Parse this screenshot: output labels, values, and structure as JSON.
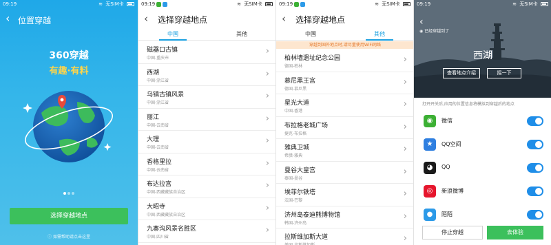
{
  "statusbar": {
    "time": "09:19",
    "carrier": "无SIM卡"
  },
  "panel1": {
    "back_icon": "chevron-left-icon",
    "title": "位置穿越",
    "brand_line1": "360穿越",
    "brand_line2": "有趣·有料",
    "button": "选择穿越地点",
    "hint": "如需帮助请点击这里",
    "colors": {
      "bg": "#1fa8e8",
      "button": "#3cc05c",
      "accent": "#ffd54a"
    }
  },
  "panel2": {
    "title": "选择穿越地点",
    "tabs": [
      "中国",
      "其他"
    ],
    "active_tab": 0,
    "items": [
      {
        "name": "磁器口古镇",
        "sub": "中国-重庆市"
      },
      {
        "name": "西湖",
        "sub": "中国-浙江省"
      },
      {
        "name": "乌镇古镇风景",
        "sub": "中国-浙江省"
      },
      {
        "name": "丽江",
        "sub": "中国-云南省"
      },
      {
        "name": "大理",
        "sub": "中国-云南省"
      },
      {
        "name": "香格里拉",
        "sub": "中国-云南省"
      },
      {
        "name": "布达拉宫",
        "sub": "中国-西藏藏族自治区"
      },
      {
        "name": "大昭寺",
        "sub": "中国-西藏藏族自治区"
      },
      {
        "name": "九寨沟风景名胜区",
        "sub": "中国-四川省"
      }
    ]
  },
  "panel3": {
    "title": "选择穿越地点",
    "tabs": [
      "中国",
      "其他"
    ],
    "active_tab": 1,
    "notice": "穿越到国外地点时,请尽量使用WiFi网络",
    "items": [
      {
        "name": "柏林墙遗址纪念公园",
        "sub": "德国-柏林"
      },
      {
        "name": "慕尼黑王宫",
        "sub": "德国-慕尼黑"
      },
      {
        "name": "星光大道",
        "sub": "中国-香港"
      },
      {
        "name": "布拉格老城广场",
        "sub": "捷克-布拉格"
      },
      {
        "name": "雅典卫城",
        "sub": "希腊-雅典"
      },
      {
        "name": "曼谷大皇宫",
        "sub": "泰国-曼谷"
      },
      {
        "name": "埃菲尔铁塔",
        "sub": "法国-巴黎"
      },
      {
        "name": "济州岛泰迪熊博物馆",
        "sub": "韩国-济州岛"
      },
      {
        "name": "拉斯维加斯大道",
        "sub": "美国-拉斯维加斯"
      }
    ]
  },
  "panel4": {
    "small": "已经穿越到了",
    "place": "西湖",
    "btn_info": "查看地点介绍",
    "btn_shake": "摇一下",
    "perm_note": "打开开关后,应用的位置信息将模拟到穿越后的地点",
    "apps": [
      {
        "name": "微信",
        "icon": "wechat-icon",
        "color": "#3cb034",
        "on": true
      },
      {
        "name": "QQ空间",
        "icon": "qzone-icon",
        "color": "#2f7fe0",
        "on": true
      },
      {
        "name": "QQ",
        "icon": "qq-icon",
        "color": "#1a1a1a",
        "on": true
      },
      {
        "name": "新浪微博",
        "icon": "weibo-icon",
        "color": "#e6162d",
        "on": true
      },
      {
        "name": "陌陌",
        "icon": "momo-icon",
        "color": "#2c9ae8",
        "on": true
      }
    ],
    "stop": "停止穿越",
    "go": "去体验"
  }
}
